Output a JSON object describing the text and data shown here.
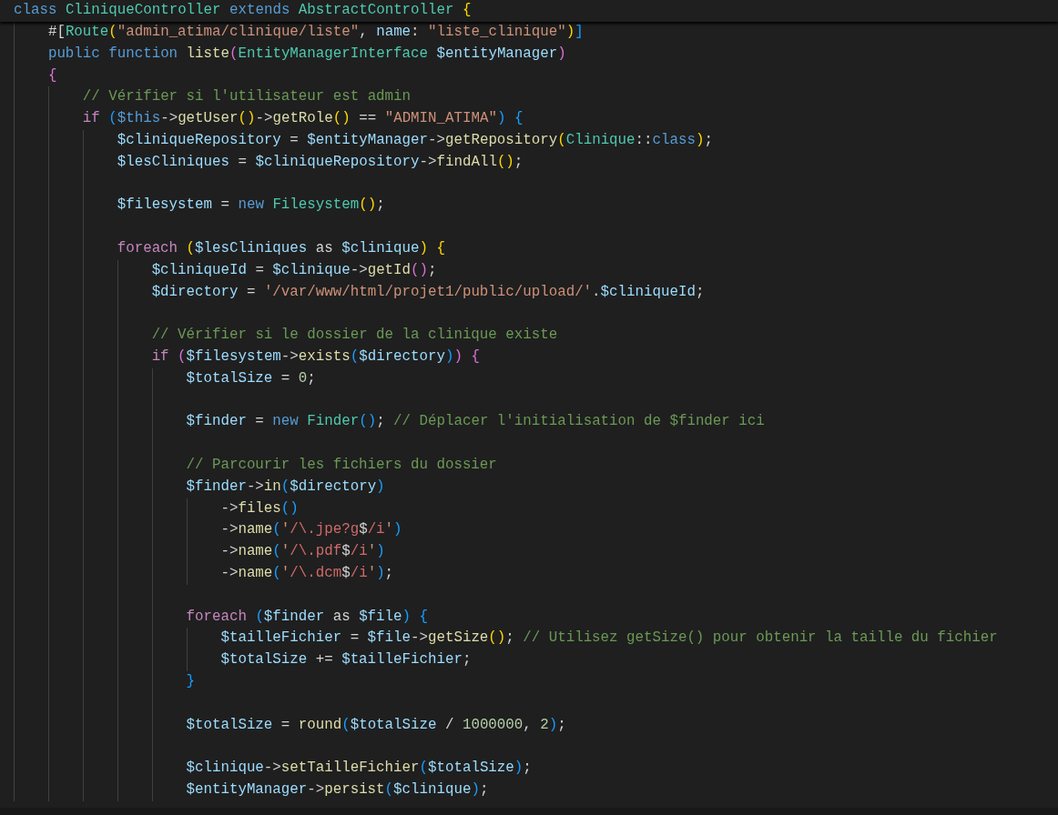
{
  "editor": {
    "sticky_line": {
      "kind": "code",
      "tokens": [
        {
          "kind": "keyword",
          "text": "class "
        },
        {
          "kind": "type",
          "text": "CliniqueController "
        },
        {
          "kind": "keyword",
          "text": "extends "
        },
        {
          "kind": "type",
          "text": "AbstractController "
        },
        {
          "kind": "bracket1",
          "text": "{"
        }
      ]
    },
    "lines": [
      {
        "kind": "code",
        "tokens": [
          {
            "kind": "plain",
            "text": "    #["
          },
          {
            "kind": "type",
            "text": "Route"
          },
          {
            "kind": "bracket1",
            "text": "("
          },
          {
            "kind": "string",
            "text": "\"admin_atima/clinique/liste\""
          },
          {
            "kind": "plain",
            "text": ", "
          },
          {
            "kind": "variable",
            "text": "name"
          },
          {
            "kind": "plain",
            "text": ": "
          },
          {
            "kind": "string",
            "text": "\"liste_clinique\""
          },
          {
            "kind": "bracket1",
            "text": ")"
          },
          {
            "kind": "bracket3",
            "text": "]"
          }
        ]
      },
      {
        "kind": "code",
        "tokens": [
          {
            "kind": "keyword",
            "text": "    public "
          },
          {
            "kind": "keyword",
            "text": "function "
          },
          {
            "kind": "function",
            "text": "liste"
          },
          {
            "kind": "bracket2",
            "text": "("
          },
          {
            "kind": "type",
            "text": "EntityManagerInterface "
          },
          {
            "kind": "variable",
            "text": "$entityManager"
          },
          {
            "kind": "bracket2",
            "text": ")"
          }
        ]
      },
      {
        "kind": "code",
        "tokens": [
          {
            "kind": "bracket2",
            "text": "    {"
          }
        ]
      },
      {
        "kind": "code",
        "tokens": [
          {
            "kind": "comment",
            "text": "        // Vérifier si l'utilisateur est admin"
          }
        ]
      },
      {
        "kind": "code",
        "tokens": [
          {
            "kind": "control",
            "text": "        if "
          },
          {
            "kind": "bracket3",
            "text": "("
          },
          {
            "kind": "keyword",
            "text": "$this"
          },
          {
            "kind": "plain",
            "text": "->"
          },
          {
            "kind": "function",
            "text": "getUser"
          },
          {
            "kind": "bracket1",
            "text": "()"
          },
          {
            "kind": "plain",
            "text": "->"
          },
          {
            "kind": "function",
            "text": "getRole"
          },
          {
            "kind": "bracket1",
            "text": "()"
          },
          {
            "kind": "plain",
            "text": " == "
          },
          {
            "kind": "string",
            "text": "\"ADMIN_ATIMA\""
          },
          {
            "kind": "bracket3",
            "text": ") "
          },
          {
            "kind": "bracket3",
            "text": "{"
          }
        ]
      },
      {
        "kind": "code",
        "tokens": [
          {
            "kind": "variable",
            "text": "            $cliniqueRepository"
          },
          {
            "kind": "plain",
            "text": " = "
          },
          {
            "kind": "variable",
            "text": "$entityManager"
          },
          {
            "kind": "plain",
            "text": "->"
          },
          {
            "kind": "function",
            "text": "getRepository"
          },
          {
            "kind": "bracket1",
            "text": "("
          },
          {
            "kind": "type",
            "text": "Clinique"
          },
          {
            "kind": "plain",
            "text": "::"
          },
          {
            "kind": "keyword",
            "text": "class"
          },
          {
            "kind": "bracket1",
            "text": ")"
          },
          {
            "kind": "plain",
            "text": ";"
          }
        ]
      },
      {
        "kind": "code",
        "tokens": [
          {
            "kind": "variable",
            "text": "            $lesCliniques"
          },
          {
            "kind": "plain",
            "text": " = "
          },
          {
            "kind": "variable",
            "text": "$cliniqueRepository"
          },
          {
            "kind": "plain",
            "text": "->"
          },
          {
            "kind": "function",
            "text": "findAll"
          },
          {
            "kind": "bracket1",
            "text": "()"
          },
          {
            "kind": "plain",
            "text": ";"
          }
        ]
      },
      {
        "kind": "blank"
      },
      {
        "kind": "code",
        "tokens": [
          {
            "kind": "variable",
            "text": "            $filesystem"
          },
          {
            "kind": "plain",
            "text": " = "
          },
          {
            "kind": "keyword",
            "text": "new "
          },
          {
            "kind": "type",
            "text": "Filesystem"
          },
          {
            "kind": "bracket1",
            "text": "()"
          },
          {
            "kind": "plain",
            "text": ";"
          }
        ]
      },
      {
        "kind": "blank"
      },
      {
        "kind": "code",
        "tokens": [
          {
            "kind": "control",
            "text": "            foreach "
          },
          {
            "kind": "bracket1",
            "text": "("
          },
          {
            "kind": "variable",
            "text": "$lesCliniques"
          },
          {
            "kind": "plain",
            "text": " as "
          },
          {
            "kind": "variable",
            "text": "$clinique"
          },
          {
            "kind": "bracket1",
            "text": ") "
          },
          {
            "kind": "bracket1",
            "text": "{"
          }
        ]
      },
      {
        "kind": "code",
        "tokens": [
          {
            "kind": "variable",
            "text": "                $cliniqueId"
          },
          {
            "kind": "plain",
            "text": " = "
          },
          {
            "kind": "variable",
            "text": "$clinique"
          },
          {
            "kind": "plain",
            "text": "->"
          },
          {
            "kind": "function",
            "text": "getId"
          },
          {
            "kind": "bracket2",
            "text": "()"
          },
          {
            "kind": "plain",
            "text": ";"
          }
        ]
      },
      {
        "kind": "code",
        "tokens": [
          {
            "kind": "variable",
            "text": "                $directory"
          },
          {
            "kind": "plain",
            "text": " = "
          },
          {
            "kind": "string",
            "text": "'/var/www/html/projet1/public/upload/'"
          },
          {
            "kind": "plain",
            "text": "."
          },
          {
            "kind": "variable",
            "text": "$cliniqueId"
          },
          {
            "kind": "plain",
            "text": ";"
          }
        ]
      },
      {
        "kind": "blank"
      },
      {
        "kind": "code",
        "tokens": [
          {
            "kind": "comment",
            "text": "                // Vérifier si le dossier de la clinique existe"
          }
        ]
      },
      {
        "kind": "code",
        "tokens": [
          {
            "kind": "control",
            "text": "                if "
          },
          {
            "kind": "bracket2",
            "text": "("
          },
          {
            "kind": "variable",
            "text": "$filesystem"
          },
          {
            "kind": "plain",
            "text": "->"
          },
          {
            "kind": "function",
            "text": "exists"
          },
          {
            "kind": "bracket3",
            "text": "("
          },
          {
            "kind": "variable",
            "text": "$directory"
          },
          {
            "kind": "bracket3",
            "text": ")"
          },
          {
            "kind": "bracket2",
            "text": ") "
          },
          {
            "kind": "bracket2",
            "text": "{"
          }
        ]
      },
      {
        "kind": "code",
        "tokens": [
          {
            "kind": "variable",
            "text": "                    $totalSize"
          },
          {
            "kind": "plain",
            "text": " = "
          },
          {
            "kind": "number",
            "text": "0"
          },
          {
            "kind": "plain",
            "text": ";"
          }
        ]
      },
      {
        "kind": "blank"
      },
      {
        "kind": "code",
        "tokens": [
          {
            "kind": "variable",
            "text": "                    $finder"
          },
          {
            "kind": "plain",
            "text": " = "
          },
          {
            "kind": "keyword",
            "text": "new "
          },
          {
            "kind": "type",
            "text": "Finder"
          },
          {
            "kind": "bracket3",
            "text": "()"
          },
          {
            "kind": "plain",
            "text": "; "
          },
          {
            "kind": "comment",
            "text": "// Déplacer l'initialisation de $finder ici"
          }
        ]
      },
      {
        "kind": "blank"
      },
      {
        "kind": "code",
        "tokens": [
          {
            "kind": "comment",
            "text": "                    // Parcourir les fichiers du dossier"
          }
        ]
      },
      {
        "kind": "code",
        "tokens": [
          {
            "kind": "variable",
            "text": "                    $finder"
          },
          {
            "kind": "plain",
            "text": "->"
          },
          {
            "kind": "function",
            "text": "in"
          },
          {
            "kind": "bracket3",
            "text": "("
          },
          {
            "kind": "variable",
            "text": "$directory"
          },
          {
            "kind": "bracket3",
            "text": ")"
          }
        ]
      },
      {
        "kind": "code",
        "tokens": [
          {
            "kind": "plain",
            "text": "                        ->"
          },
          {
            "kind": "function",
            "text": "files"
          },
          {
            "kind": "bracket3",
            "text": "()"
          }
        ]
      },
      {
        "kind": "code",
        "tokens": [
          {
            "kind": "plain",
            "text": "                        ->"
          },
          {
            "kind": "function",
            "text": "name"
          },
          {
            "kind": "bracket3",
            "text": "("
          },
          {
            "kind": "string",
            "text": "'"
          },
          {
            "kind": "regex",
            "text": "/\\.jpe?g"
          },
          {
            "kind": "plain",
            "text": "$"
          },
          {
            "kind": "regex",
            "text": "/i"
          },
          {
            "kind": "string",
            "text": "'"
          },
          {
            "kind": "bracket3",
            "text": ")"
          }
        ]
      },
      {
        "kind": "code",
        "tokens": [
          {
            "kind": "plain",
            "text": "                        ->"
          },
          {
            "kind": "function",
            "text": "name"
          },
          {
            "kind": "bracket3",
            "text": "("
          },
          {
            "kind": "string",
            "text": "'"
          },
          {
            "kind": "regex",
            "text": "/\\.pdf"
          },
          {
            "kind": "plain",
            "text": "$"
          },
          {
            "kind": "regex",
            "text": "/i"
          },
          {
            "kind": "string",
            "text": "'"
          },
          {
            "kind": "bracket3",
            "text": ")"
          }
        ]
      },
      {
        "kind": "code",
        "tokens": [
          {
            "kind": "plain",
            "text": "                        ->"
          },
          {
            "kind": "function",
            "text": "name"
          },
          {
            "kind": "bracket3",
            "text": "("
          },
          {
            "kind": "string",
            "text": "'"
          },
          {
            "kind": "regex",
            "text": "/\\.dcm"
          },
          {
            "kind": "plain",
            "text": "$"
          },
          {
            "kind": "regex",
            "text": "/i"
          },
          {
            "kind": "string",
            "text": "'"
          },
          {
            "kind": "bracket3",
            "text": ")"
          },
          {
            "kind": "plain",
            "text": ";"
          }
        ]
      },
      {
        "kind": "blank"
      },
      {
        "kind": "code",
        "tokens": [
          {
            "kind": "control",
            "text": "                    foreach "
          },
          {
            "kind": "bracket3",
            "text": "("
          },
          {
            "kind": "variable",
            "text": "$finder"
          },
          {
            "kind": "plain",
            "text": " as "
          },
          {
            "kind": "variable",
            "text": "$file"
          },
          {
            "kind": "bracket3",
            "text": ") "
          },
          {
            "kind": "bracket3",
            "text": "{"
          }
        ]
      },
      {
        "kind": "code",
        "tokens": [
          {
            "kind": "variable",
            "text": "                        $tailleFichier"
          },
          {
            "kind": "plain",
            "text": " = "
          },
          {
            "kind": "variable",
            "text": "$file"
          },
          {
            "kind": "plain",
            "text": "->"
          },
          {
            "kind": "function",
            "text": "getSize"
          },
          {
            "kind": "bracket1",
            "text": "()"
          },
          {
            "kind": "plain",
            "text": "; "
          },
          {
            "kind": "comment",
            "text": "// Utilisez getSize() pour obtenir la taille du fichier"
          }
        ]
      },
      {
        "kind": "code",
        "tokens": [
          {
            "kind": "variable",
            "text": "                        $totalSize"
          },
          {
            "kind": "plain",
            "text": " += "
          },
          {
            "kind": "variable",
            "text": "$tailleFichier"
          },
          {
            "kind": "plain",
            "text": ";"
          }
        ]
      },
      {
        "kind": "code",
        "tokens": [
          {
            "kind": "bracket3",
            "text": "                    }"
          }
        ]
      },
      {
        "kind": "blank"
      },
      {
        "kind": "code",
        "tokens": [
          {
            "kind": "variable",
            "text": "                    $totalSize"
          },
          {
            "kind": "plain",
            "text": " = "
          },
          {
            "kind": "function",
            "text": "round"
          },
          {
            "kind": "bracket3",
            "text": "("
          },
          {
            "kind": "variable",
            "text": "$totalSize"
          },
          {
            "kind": "plain",
            "text": " / "
          },
          {
            "kind": "number",
            "text": "1000000"
          },
          {
            "kind": "plain",
            "text": ", "
          },
          {
            "kind": "number",
            "text": "2"
          },
          {
            "kind": "bracket3",
            "text": ")"
          },
          {
            "kind": "plain",
            "text": ";"
          }
        ]
      },
      {
        "kind": "blank"
      },
      {
        "kind": "code",
        "tokens": [
          {
            "kind": "variable",
            "text": "                    $clinique"
          },
          {
            "kind": "plain",
            "text": "->"
          },
          {
            "kind": "function",
            "text": "setTailleFichier"
          },
          {
            "kind": "bracket3",
            "text": "("
          },
          {
            "kind": "variable",
            "text": "$totalSize"
          },
          {
            "kind": "bracket3",
            "text": ")"
          },
          {
            "kind": "plain",
            "text": ";"
          }
        ]
      },
      {
        "kind": "code",
        "tokens": [
          {
            "kind": "variable",
            "text": "                    $entityManager"
          },
          {
            "kind": "plain",
            "text": "->"
          },
          {
            "kind": "function",
            "text": "persist"
          },
          {
            "kind": "bracket3",
            "text": "("
          },
          {
            "kind": "variable",
            "text": "$clinique"
          },
          {
            "kind": "bracket3",
            "text": ")"
          },
          {
            "kind": "plain",
            "text": ";"
          }
        ]
      }
    ]
  }
}
